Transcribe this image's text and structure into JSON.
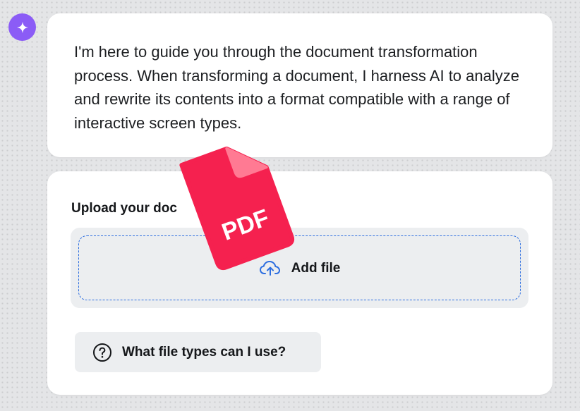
{
  "assistant": {
    "avatar_icon": "sparkle-icon",
    "accent_color": "#8b5cf6"
  },
  "message": {
    "text": "I'm here to guide you through the document transformation process. When transforming a document, I harness AI to analyze and rewrite its contents into a format compatible with a range of interactive screen types."
  },
  "upload": {
    "label": "Upload your doc",
    "add_file_label": "Add file",
    "add_file_icon": "cloud-upload-icon",
    "dropzone_border_color": "#2b6de0"
  },
  "pdf_badge": {
    "text": "PDF",
    "icon": "pdf-file-icon",
    "color": "#f5214f"
  },
  "help": {
    "label": "What file types can I use?",
    "icon": "question-circle-icon"
  }
}
